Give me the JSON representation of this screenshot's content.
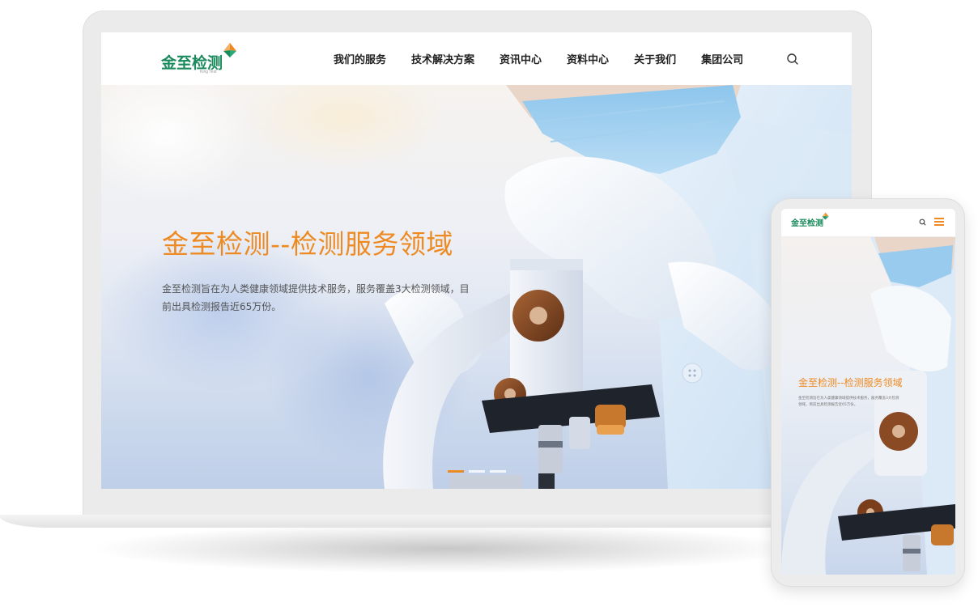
{
  "desktop": {
    "logo": {
      "text": "金至检测",
      "sub": "King Test"
    },
    "nav": [
      "我们的服务",
      "技术解决方案",
      "资讯中心",
      "资料中心",
      "关于我们",
      "集团公司"
    ],
    "hero": {
      "title": "金至检测--检测服务领域",
      "description": "金至检测旨在为人类健康领域提供技术服务，服务覆盖3大检测领域，目前出具检测报告近65万份。"
    },
    "slider": {
      "slides": 3,
      "active": 1
    }
  },
  "mobile": {
    "logo": {
      "text": "金至检测"
    },
    "hero": {
      "title": "金至检测--检测服务领域",
      "description": "金至检测旨在为人类健康领域提供技术服务，服务覆盖3大检测领域，目前出具检测报告近65万份。"
    }
  },
  "icons": {
    "search": "search-icon",
    "menu": "menu-icon",
    "logo_mark": "logo-mark-icon"
  },
  "colors": {
    "brand_green": "#1a8a5c",
    "accent_orange": "#ee8a22"
  }
}
